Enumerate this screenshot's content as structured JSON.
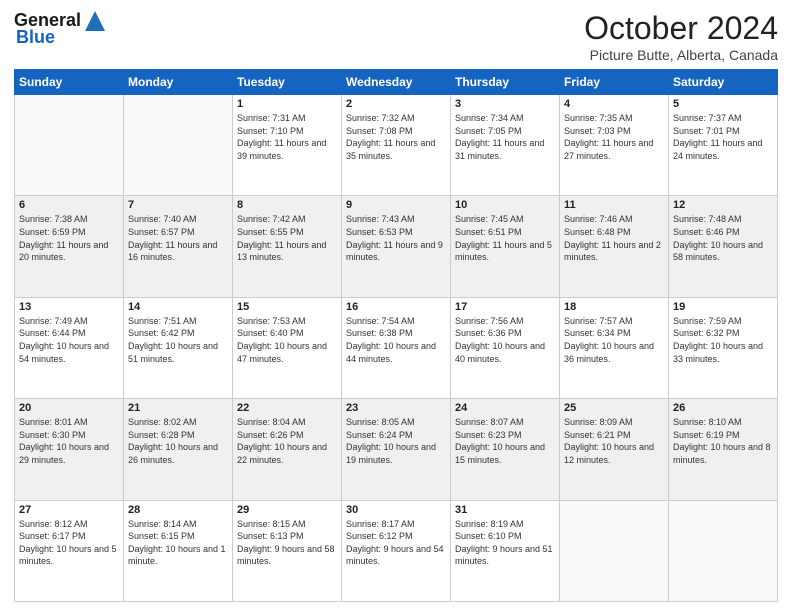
{
  "header": {
    "logo_line1": "General",
    "logo_line2": "Blue",
    "month_title": "October 2024",
    "location": "Picture Butte, Alberta, Canada"
  },
  "days_of_week": [
    "Sunday",
    "Monday",
    "Tuesday",
    "Wednesday",
    "Thursday",
    "Friday",
    "Saturday"
  ],
  "weeks": [
    [
      {
        "day": "",
        "info": ""
      },
      {
        "day": "",
        "info": ""
      },
      {
        "day": "1",
        "info": "Sunrise: 7:31 AM\nSunset: 7:10 PM\nDaylight: 11 hours and 39 minutes."
      },
      {
        "day": "2",
        "info": "Sunrise: 7:32 AM\nSunset: 7:08 PM\nDaylight: 11 hours and 35 minutes."
      },
      {
        "day": "3",
        "info": "Sunrise: 7:34 AM\nSunset: 7:05 PM\nDaylight: 11 hours and 31 minutes."
      },
      {
        "day": "4",
        "info": "Sunrise: 7:35 AM\nSunset: 7:03 PM\nDaylight: 11 hours and 27 minutes."
      },
      {
        "day": "5",
        "info": "Sunrise: 7:37 AM\nSunset: 7:01 PM\nDaylight: 11 hours and 24 minutes."
      }
    ],
    [
      {
        "day": "6",
        "info": "Sunrise: 7:38 AM\nSunset: 6:59 PM\nDaylight: 11 hours and 20 minutes."
      },
      {
        "day": "7",
        "info": "Sunrise: 7:40 AM\nSunset: 6:57 PM\nDaylight: 11 hours and 16 minutes."
      },
      {
        "day": "8",
        "info": "Sunrise: 7:42 AM\nSunset: 6:55 PM\nDaylight: 11 hours and 13 minutes."
      },
      {
        "day": "9",
        "info": "Sunrise: 7:43 AM\nSunset: 6:53 PM\nDaylight: 11 hours and 9 minutes."
      },
      {
        "day": "10",
        "info": "Sunrise: 7:45 AM\nSunset: 6:51 PM\nDaylight: 11 hours and 5 minutes."
      },
      {
        "day": "11",
        "info": "Sunrise: 7:46 AM\nSunset: 6:48 PM\nDaylight: 11 hours and 2 minutes."
      },
      {
        "day": "12",
        "info": "Sunrise: 7:48 AM\nSunset: 6:46 PM\nDaylight: 10 hours and 58 minutes."
      }
    ],
    [
      {
        "day": "13",
        "info": "Sunrise: 7:49 AM\nSunset: 6:44 PM\nDaylight: 10 hours and 54 minutes."
      },
      {
        "day": "14",
        "info": "Sunrise: 7:51 AM\nSunset: 6:42 PM\nDaylight: 10 hours and 51 minutes."
      },
      {
        "day": "15",
        "info": "Sunrise: 7:53 AM\nSunset: 6:40 PM\nDaylight: 10 hours and 47 minutes."
      },
      {
        "day": "16",
        "info": "Sunrise: 7:54 AM\nSunset: 6:38 PM\nDaylight: 10 hours and 44 minutes."
      },
      {
        "day": "17",
        "info": "Sunrise: 7:56 AM\nSunset: 6:36 PM\nDaylight: 10 hours and 40 minutes."
      },
      {
        "day": "18",
        "info": "Sunrise: 7:57 AM\nSunset: 6:34 PM\nDaylight: 10 hours and 36 minutes."
      },
      {
        "day": "19",
        "info": "Sunrise: 7:59 AM\nSunset: 6:32 PM\nDaylight: 10 hours and 33 minutes."
      }
    ],
    [
      {
        "day": "20",
        "info": "Sunrise: 8:01 AM\nSunset: 6:30 PM\nDaylight: 10 hours and 29 minutes."
      },
      {
        "day": "21",
        "info": "Sunrise: 8:02 AM\nSunset: 6:28 PM\nDaylight: 10 hours and 26 minutes."
      },
      {
        "day": "22",
        "info": "Sunrise: 8:04 AM\nSunset: 6:26 PM\nDaylight: 10 hours and 22 minutes."
      },
      {
        "day": "23",
        "info": "Sunrise: 8:05 AM\nSunset: 6:24 PM\nDaylight: 10 hours and 19 minutes."
      },
      {
        "day": "24",
        "info": "Sunrise: 8:07 AM\nSunset: 6:23 PM\nDaylight: 10 hours and 15 minutes."
      },
      {
        "day": "25",
        "info": "Sunrise: 8:09 AM\nSunset: 6:21 PM\nDaylight: 10 hours and 12 minutes."
      },
      {
        "day": "26",
        "info": "Sunrise: 8:10 AM\nSunset: 6:19 PM\nDaylight: 10 hours and 8 minutes."
      }
    ],
    [
      {
        "day": "27",
        "info": "Sunrise: 8:12 AM\nSunset: 6:17 PM\nDaylight: 10 hours and 5 minutes."
      },
      {
        "day": "28",
        "info": "Sunrise: 8:14 AM\nSunset: 6:15 PM\nDaylight: 10 hours and 1 minute."
      },
      {
        "day": "29",
        "info": "Sunrise: 8:15 AM\nSunset: 6:13 PM\nDaylight: 9 hours and 58 minutes."
      },
      {
        "day": "30",
        "info": "Sunrise: 8:17 AM\nSunset: 6:12 PM\nDaylight: 9 hours and 54 minutes."
      },
      {
        "day": "31",
        "info": "Sunrise: 8:19 AM\nSunset: 6:10 PM\nDaylight: 9 hours and 51 minutes."
      },
      {
        "day": "",
        "info": ""
      },
      {
        "day": "",
        "info": ""
      }
    ]
  ]
}
